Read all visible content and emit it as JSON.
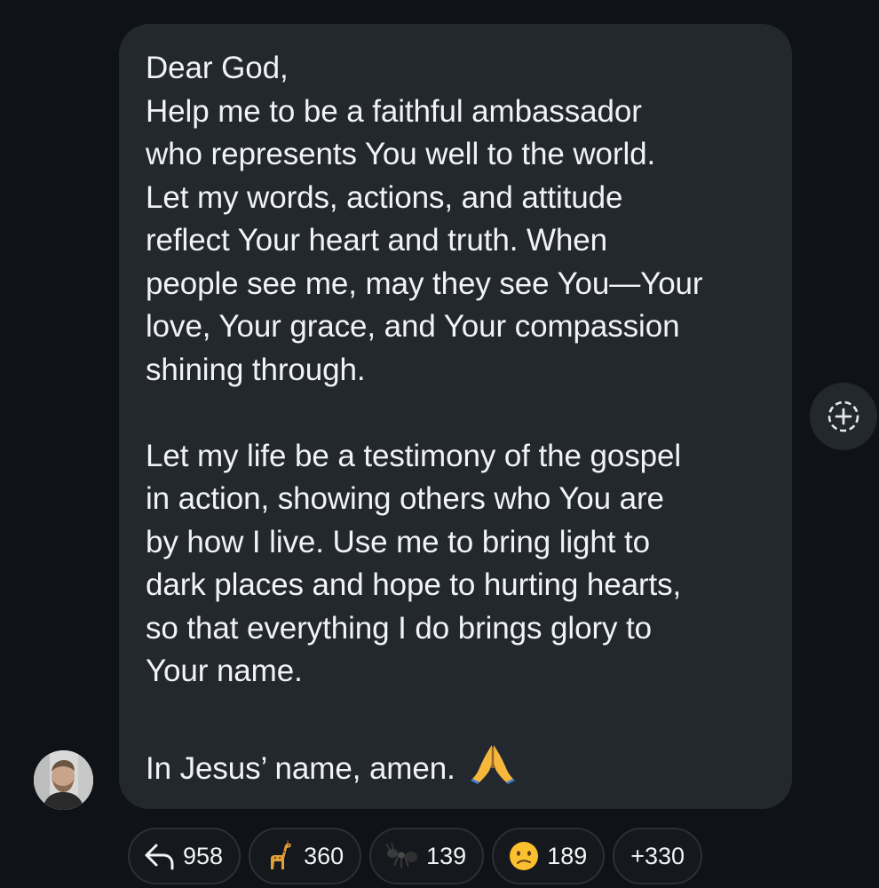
{
  "message": {
    "greeting": "Dear God,",
    "paragraph1": [
      "Help me to be a faithful ambassador",
      "who represents You well to the world.",
      "Let my words, actions, and attitude",
      "reflect Your heart and truth. When",
      "people see me, may they see You—Your",
      "love, Your grace, and Your compassion",
      "shining through."
    ],
    "paragraph2": [
      "Let my life be a testimony of the gospel",
      "in action, showing others who You are",
      "by how I live. Use me to bring light to",
      "dark places and hope to hurting hearts,",
      "so that everything I do brings glory to",
      "Your name."
    ],
    "closing": "In Jesus’ name, amen.",
    "closing_emoji": "folded-hands-icon"
  },
  "reactions": [
    {
      "icon": "reply-arrow-icon",
      "count": "958"
    },
    {
      "icon": "giraffe-icon",
      "count": "360"
    },
    {
      "icon": "ant-icon",
      "count": "139"
    },
    {
      "icon": "confused-face-icon",
      "count": "189"
    },
    {
      "icon": "",
      "count": "+330"
    }
  ],
  "colors": {
    "background": "#0f1217",
    "bubble": "#23272e",
    "text": "#f1f3f5",
    "pill_border": "#2b3038"
  }
}
